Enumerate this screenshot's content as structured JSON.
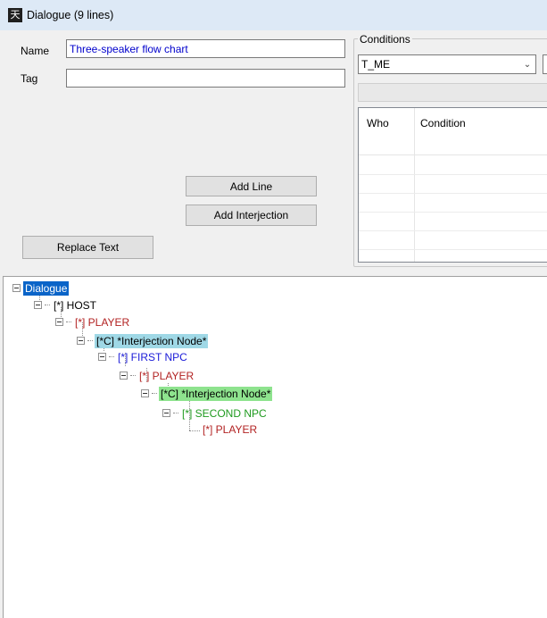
{
  "window": {
    "title": "Dialogue (9 lines)",
    "icon": "app-glyph-icon"
  },
  "form": {
    "name_label": "Name",
    "name_value": "Three-speaker flow chart",
    "tag_label": "Tag",
    "tag_value": ""
  },
  "buttons": {
    "add_line": "Add Line",
    "add_interjection": "Add Interjection",
    "replace_text": "Replace Text"
  },
  "conditions": {
    "legend": "Conditions",
    "selected": "T_ME",
    "columns": [
      "Who",
      "Condition"
    ]
  },
  "tree": [
    {
      "text": "Dialogue",
      "color": "#ffffff",
      "bg": "#0a64c8",
      "expander": true
    },
    {
      "text": "[*] HOST",
      "color": "#000000",
      "bg": "",
      "expander": true
    },
    {
      "text": "[*] PLAYER",
      "color": "#b22222",
      "bg": "",
      "expander": true
    },
    {
      "text": "[*C] *Interjection Node*",
      "color": "#000000",
      "bg": "#9fd8e6",
      "expander": true
    },
    {
      "text": "[*] FIRST NPC",
      "color": "#1a1ad8",
      "bg": "",
      "expander": true
    },
    {
      "text": "[*] PLAYER",
      "color": "#b22222",
      "bg": "",
      "expander": true
    },
    {
      "text": "[*C] *Interjection Node*",
      "color": "#000000",
      "bg": "#8ee38e",
      "expander": true
    },
    {
      "text": "[*] SECOND NPC",
      "color": "#1f9a1f",
      "bg": "",
      "expander": true
    },
    {
      "text": "[*] PLAYER",
      "color": "#b22222",
      "bg": "",
      "expander": false
    }
  ]
}
